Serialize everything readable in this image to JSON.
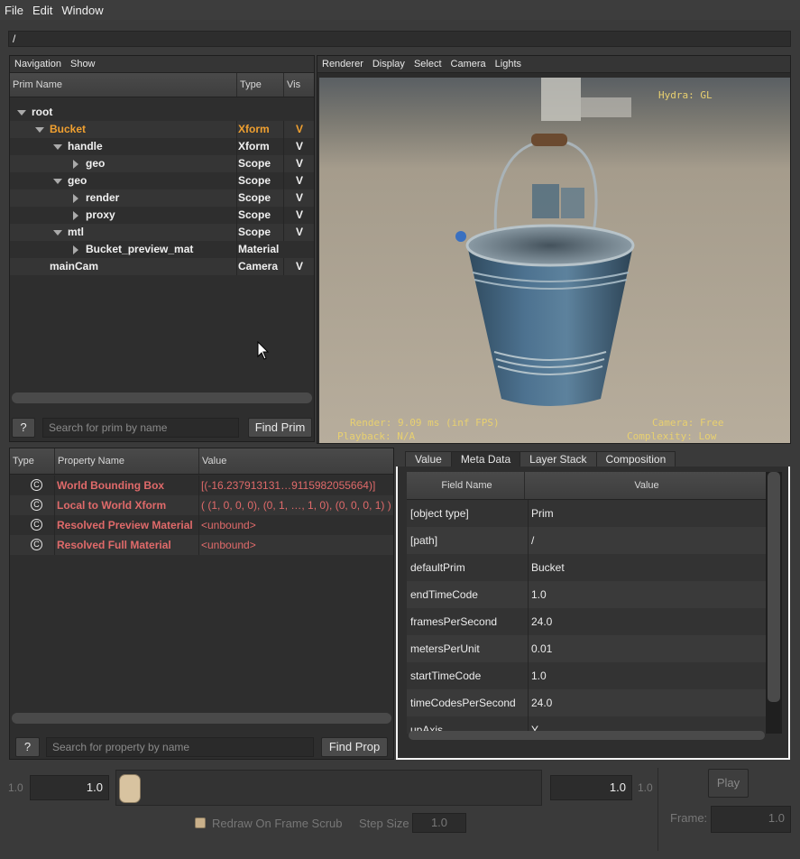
{
  "menu": [
    "File",
    "Edit",
    "Window"
  ],
  "path": "/",
  "prim_tab_bar": [
    "Navigation",
    "Show"
  ],
  "prim_columns": {
    "name": "Prim Name",
    "type": "Type",
    "vis": "Vis"
  },
  "prims": [
    {
      "name": "root",
      "type": "",
      "vis": "",
      "expanded": true
    },
    {
      "name": "Bucket",
      "type": "Xform",
      "vis": "V",
      "expanded": true,
      "selected": true
    },
    {
      "name": "handle",
      "type": "Xform",
      "vis": "V",
      "expanded": true
    },
    {
      "name": "geo",
      "type": "Scope",
      "vis": "V",
      "expanded": false
    },
    {
      "name": "geo",
      "type": "Scope",
      "vis": "V",
      "expanded": true
    },
    {
      "name": "render",
      "type": "Scope",
      "vis": "V",
      "expanded": false
    },
    {
      "name": "proxy",
      "type": "Scope",
      "vis": "V",
      "expanded": false
    },
    {
      "name": "mtl",
      "type": "Scope",
      "vis": "V",
      "expanded": true
    },
    {
      "name": "Bucket_preview_mat",
      "type": "Material",
      "vis": "",
      "expanded": false
    },
    {
      "name": "mainCam",
      "type": "Camera",
      "vis": "V",
      "expanded": null
    }
  ],
  "prim_search": {
    "help": "?",
    "placeholder": "Search for prim by name",
    "button": "Find Prim"
  },
  "viewport_menu": [
    "Renderer",
    "Display",
    "Select",
    "Camera",
    "Lights"
  ],
  "hud": {
    "renderer": "Hydra: GL",
    "render": "Render: 9.09 ms (inf FPS)",
    "playback": "Playback: N/A",
    "camera": "Camera: Free",
    "complexity": "Complexity: Low"
  },
  "prop_columns": {
    "type": "Type",
    "name": "Property Name",
    "value": "Value"
  },
  "properties": [
    {
      "icon": "C",
      "name": "World Bounding Box",
      "value": "[(-16.237913131…9115982055664)]"
    },
    {
      "icon": "C",
      "name": "Local to World Xform",
      "value": "( (1, 0, 0, 0), (0, 1, …, 1, 0), (0, 0, 0, 1) )"
    },
    {
      "icon": "C",
      "name": "Resolved Preview Material",
      "value": "<unbound>"
    },
    {
      "icon": "C",
      "name": "Resolved Full Material",
      "value": "<unbound>"
    }
  ],
  "prop_search": {
    "help": "?",
    "placeholder": "Search for property by name",
    "button": "Find Prop"
  },
  "meta_tabs": [
    "Value",
    "Meta Data",
    "Layer Stack",
    "Composition"
  ],
  "meta_active_tab": 1,
  "meta_columns": {
    "field": "Field Name",
    "value": "Value"
  },
  "metadata": [
    {
      "field": "[object type]",
      "value": "Prim"
    },
    {
      "field": "[path]",
      "value": "/"
    },
    {
      "field": "defaultPrim",
      "value": "Bucket"
    },
    {
      "field": "endTimeCode",
      "value": "1.0"
    },
    {
      "field": "framesPerSecond",
      "value": "24.0"
    },
    {
      "field": "metersPerUnit",
      "value": "0.01"
    },
    {
      "field": "startTimeCode",
      "value": "1.0"
    },
    {
      "field": "timeCodesPerSecond",
      "value": "24.0"
    },
    {
      "field": "upAxis",
      "value": "Y"
    }
  ],
  "timeline": {
    "min_label": "1.0",
    "start_value": "1.0",
    "end_value": "1.0",
    "max_label": "1.0",
    "redraw_label": "Redraw On Frame Scrub",
    "step_label": "Step Size",
    "step_value": "1.0",
    "play_label": "Play",
    "frame_label": "Frame:",
    "frame_value": "1.0"
  },
  "colors": {
    "selected_prim": "#f0a030",
    "computed_prop": "#e06a6a",
    "hud_text": "#e8d070",
    "scrubber": "#d8c3a0"
  }
}
